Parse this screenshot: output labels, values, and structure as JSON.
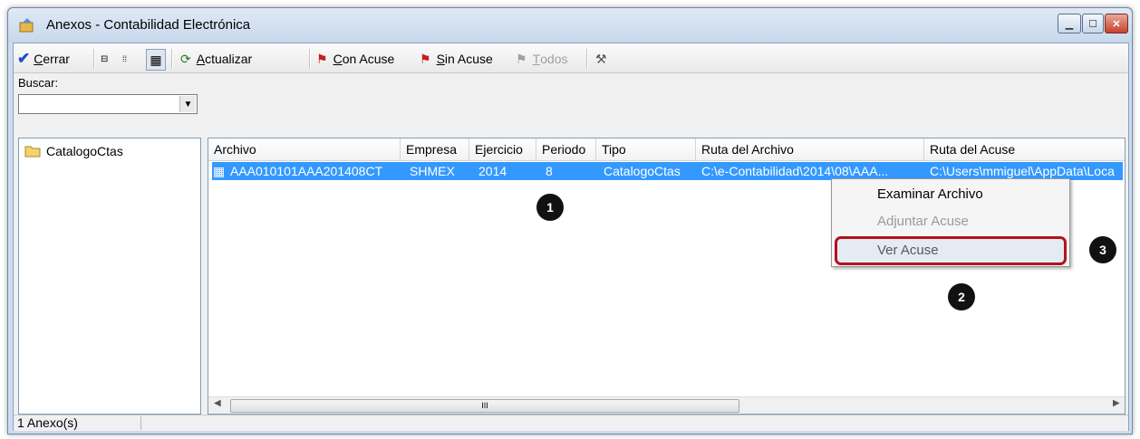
{
  "window": {
    "title": "Anexos - Contabilidad Electrónica"
  },
  "toolbar": {
    "cerrar": {
      "key": "C",
      "rest": "errar"
    },
    "actualizar": {
      "key": "A",
      "rest": "ctualizar"
    },
    "con_acuse": {
      "key": "C",
      "rest": "on Acuse"
    },
    "sin_acuse": {
      "key": "S",
      "rest": "in Acuse"
    },
    "todos": {
      "key": "T",
      "rest": "odos"
    }
  },
  "search": {
    "label": "Buscar:",
    "value": ""
  },
  "tree": {
    "items": [
      {
        "label": "CatalogoCtas"
      }
    ]
  },
  "table": {
    "columns": [
      "Archivo",
      "Empresa",
      "Ejercicio",
      "Periodo",
      "Tipo",
      "Ruta del Archivo",
      "Ruta del Acuse"
    ],
    "rows": [
      {
        "archivo": "AAA010101AAA201408CT",
        "empresa": "SHMEX",
        "ejercicio": "2014",
        "periodo": "8",
        "tipo": "CatalogoCtas",
        "ruta_archivo": "C:\\e-Contabilidad\\2014\\08\\AAA...",
        "ruta_acuse": "C:\\Users\\mmiguel\\AppData\\Loca"
      }
    ],
    "scroll_thumb": "III"
  },
  "context_menu": {
    "items": [
      "Examinar Archivo",
      "Adjuntar Acuse",
      "Ver Acuse"
    ]
  },
  "status": {
    "count": "1 Anexo(s)"
  },
  "callouts": [
    "1",
    "2",
    "3"
  ],
  "colors": {
    "selection": "#3399ff",
    "highlight": "#b3121b"
  }
}
